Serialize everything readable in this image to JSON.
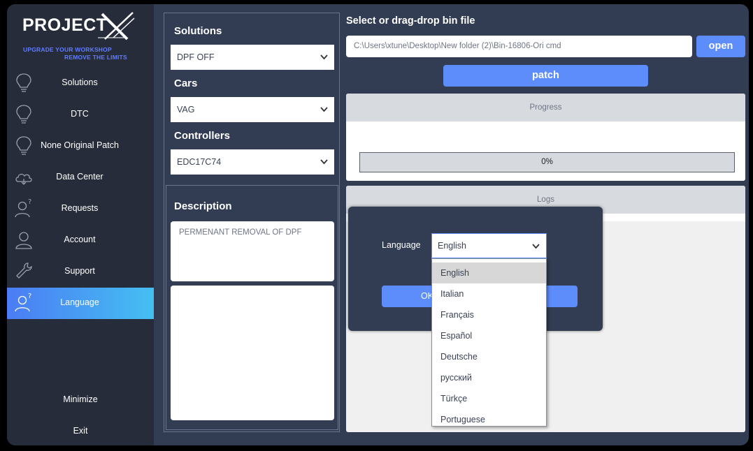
{
  "brand": {
    "name": "PROJECT",
    "tagline_line1": "UPGRADE YOUR WORKSHOP",
    "tagline_line2": "REMOVE THE LIMITS",
    "accent": "#5f7bff"
  },
  "sidebar": {
    "items": [
      {
        "label": "Solutions",
        "icon": "lightbulb-icon"
      },
      {
        "label": "DTC",
        "icon": "lightbulb-icon"
      },
      {
        "label": "None Original Patch",
        "icon": "lightbulb-icon"
      },
      {
        "label": "Data Center",
        "icon": "cloud-icon"
      },
      {
        "label": "Requests",
        "icon": "user-question-icon"
      },
      {
        "label": "Account",
        "icon": "user-icon"
      },
      {
        "label": "Support",
        "icon": "wrench-icon"
      },
      {
        "label": "Language",
        "icon": "user-question-icon",
        "active": true
      }
    ],
    "minimize_label": "Minimize",
    "exit_label": "Exit"
  },
  "filters": {
    "solutions_label": "Solutions",
    "solutions_value": "DPF OFF",
    "cars_label": "Cars",
    "cars_value": "VAG",
    "controllers_label": "Controllers",
    "controllers_value": "EDC17C74"
  },
  "description": {
    "label": "Description",
    "text": "PERMENANT REMOVAL OF DPF"
  },
  "file": {
    "label": "Select or drag-drop  bin file",
    "path": "C:\\Users\\xtune\\Desktop\\New folder (2)\\Bin-16806-Ori cmd",
    "open_label": "open",
    "patch_label": "patch"
  },
  "progress": {
    "header": "Progress",
    "percent": 0,
    "percent_text": "0%"
  },
  "logs": {
    "header": "Logs"
  },
  "language_dialog": {
    "label": "Language",
    "selected": "English",
    "ok_label": "OK",
    "options": [
      "English",
      "Italian",
      "Français",
      "Español",
      "Deutsche",
      "русский",
      "Türkçe",
      "Portuguese"
    ]
  },
  "colors": {
    "button_blue": "#5c8dfb",
    "active_gradient_start": "#4b7cf5",
    "active_gradient_end": "#45bff1",
    "panel_bg": "#323c52",
    "sidebar_bg": "#272c3a"
  }
}
